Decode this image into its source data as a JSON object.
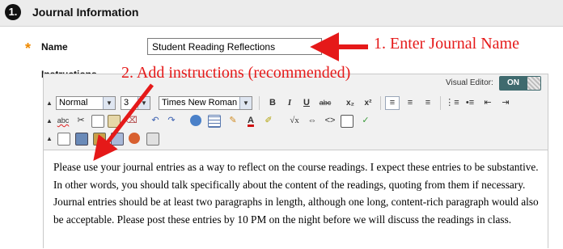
{
  "section": {
    "number": "1.",
    "title": "Journal Information"
  },
  "name_field": {
    "required_mark": "*",
    "label": "Name",
    "value": "Student Reading Reflections"
  },
  "instructions": {
    "label": "Instructions"
  },
  "callouts": {
    "enter_name": "1. Enter Journal Name",
    "add_instructions": "2. Add instructions (recommended)"
  },
  "visual_editor": {
    "label": "Visual Editor:",
    "state": "ON"
  },
  "toolbar": {
    "paragraph_style": "Normal",
    "font_size": "3",
    "font_family": "Times New Roman",
    "bold": "B",
    "italic": "I",
    "underline": "U",
    "strikethrough": "abc",
    "subscript": "x₂",
    "superscript": "x²",
    "spellcheck": "abc"
  },
  "content": {
    "text": "Please use your journal entries as a way to reflect on the course readings.  I expect these entries to be substantive.  In other words, you should talk specifically about the content of the readings, quoting from them if necessary.  Journal entries should be at least two paragraphs in length, although one long, content-rich paragraph would also be acceptable.  Please post these entries by 10 PM on the night before we will discuss the readings in class."
  },
  "colors": {
    "accent_red": "#e51919",
    "required_orange": "#f08a00",
    "toggle_bg": "#3f6a6e"
  },
  "icons": [
    "step-number-icon",
    "align-left-icon",
    "align-center-icon",
    "align-right-icon",
    "numbered-list-icon",
    "bulleted-list-icon",
    "outdent-icon",
    "indent-icon",
    "cut-icon",
    "copy-icon",
    "paste-icon",
    "undo-icon",
    "redo-icon",
    "link-icon",
    "table-icon",
    "highlight-icon",
    "text-color-icon",
    "equation-icon",
    "html-icon",
    "fullscreen-icon",
    "image-icon",
    "media-icon"
  ]
}
